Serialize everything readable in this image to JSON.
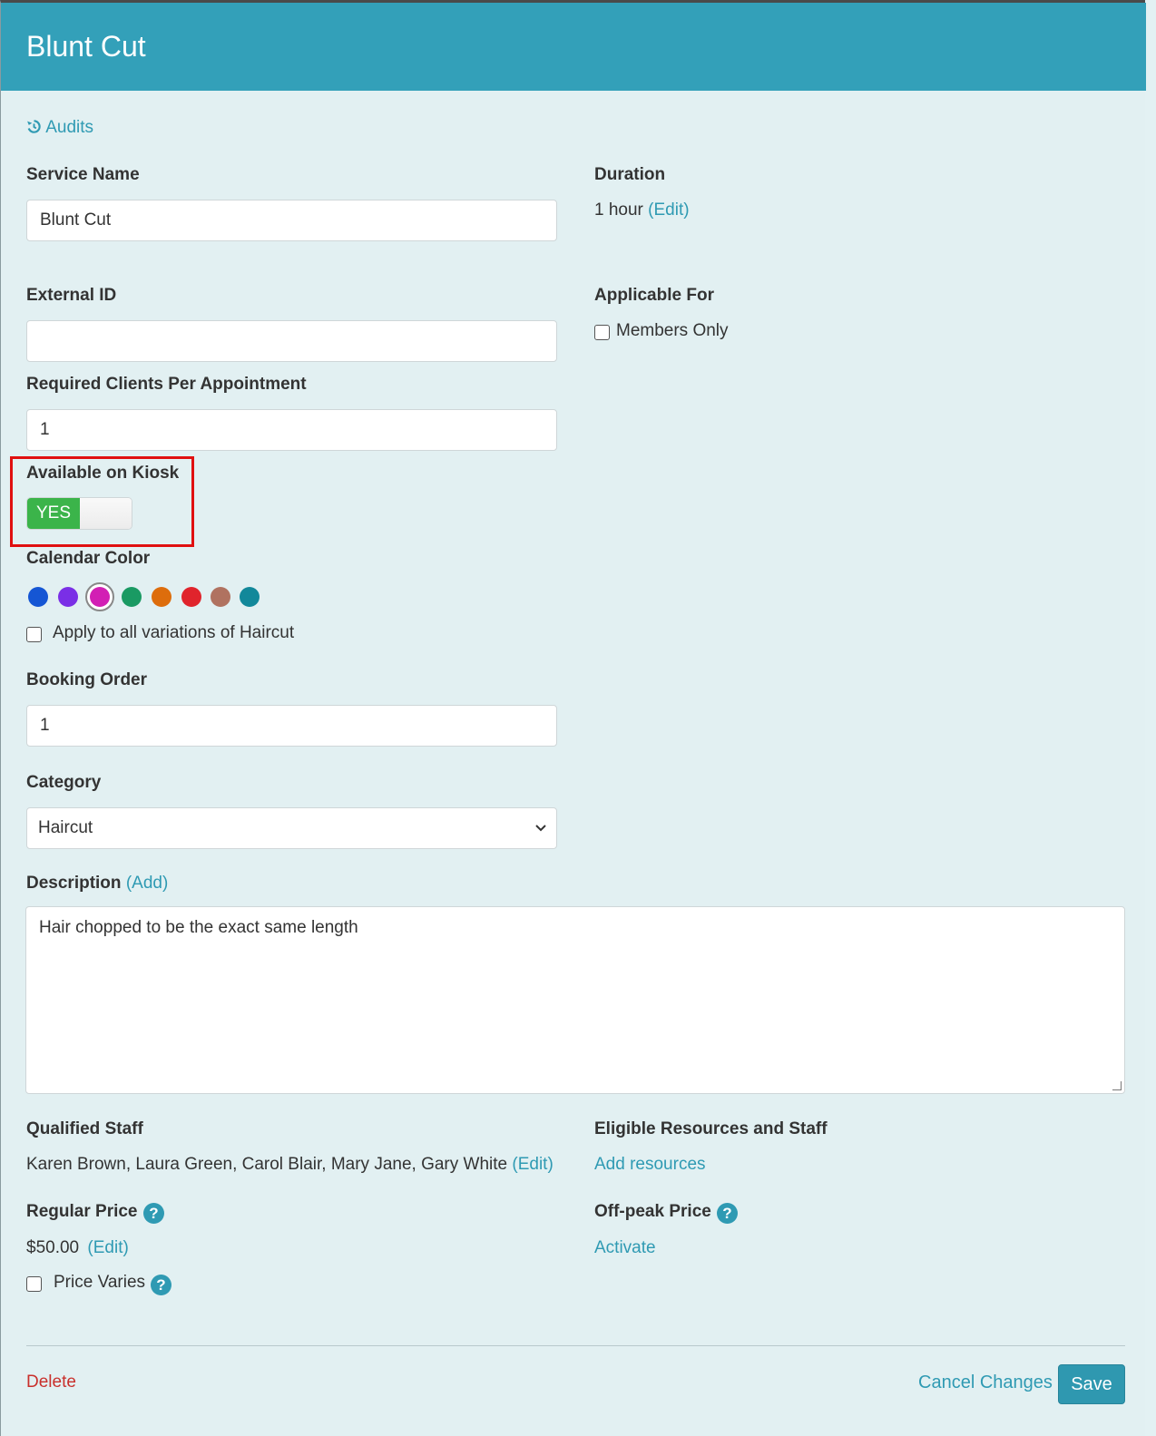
{
  "header": {
    "title": "Blunt Cut"
  },
  "audits": {
    "icon": "history-icon",
    "label": "Audits"
  },
  "service_name": {
    "label": "Service Name",
    "value": "Blunt Cut"
  },
  "duration": {
    "label": "Duration",
    "value": "1 hour",
    "edit": "(Edit)"
  },
  "external_id": {
    "label": "External ID",
    "value": ""
  },
  "applicable_for": {
    "label": "Applicable For",
    "members_only": "Members Only",
    "checked": false
  },
  "required_clients": {
    "label": "Required Clients Per Appointment",
    "value": "1"
  },
  "kiosk": {
    "label": "Available on Kiosk",
    "toggle_label": "YES",
    "enabled": true
  },
  "calendar_color": {
    "label": "Calendar Color",
    "colors": [
      "#1556d4",
      "#7a2fe6",
      "#d21fb4",
      "#1a9a63",
      "#dd6d0c",
      "#e0242c",
      "#b07260",
      "#12889a"
    ],
    "selected_index": 2,
    "apply_all": "Apply to all variations of Haircut"
  },
  "booking_order": {
    "label": "Booking Order",
    "value": "1"
  },
  "category": {
    "label": "Category",
    "value": "Haircut"
  },
  "description": {
    "label": "Description",
    "add": "(Add)",
    "value": "Hair chopped to be the exact same length"
  },
  "qualified_staff": {
    "label": "Qualified Staff",
    "value": "Karen Brown, Laura Green, Carol Blair, Mary Jane, Gary White",
    "edit": "(Edit)"
  },
  "eligible_resources": {
    "label": "Eligible Resources and Staff",
    "link": "Add resources"
  },
  "regular_price": {
    "label": "Regular Price",
    "value": "$50.00",
    "edit": "(Edit)",
    "price_varies": "Price Varies"
  },
  "offpeak_price": {
    "label": "Off-peak Price",
    "link": "Activate"
  },
  "footer": {
    "delete": "Delete",
    "cancel": "Cancel Changes",
    "save": "Save"
  },
  "colors": {
    "header": "#33a0b9",
    "link": "#2f9ab3",
    "toggle_on": "#3bb44a",
    "delete": "#c9302c"
  }
}
